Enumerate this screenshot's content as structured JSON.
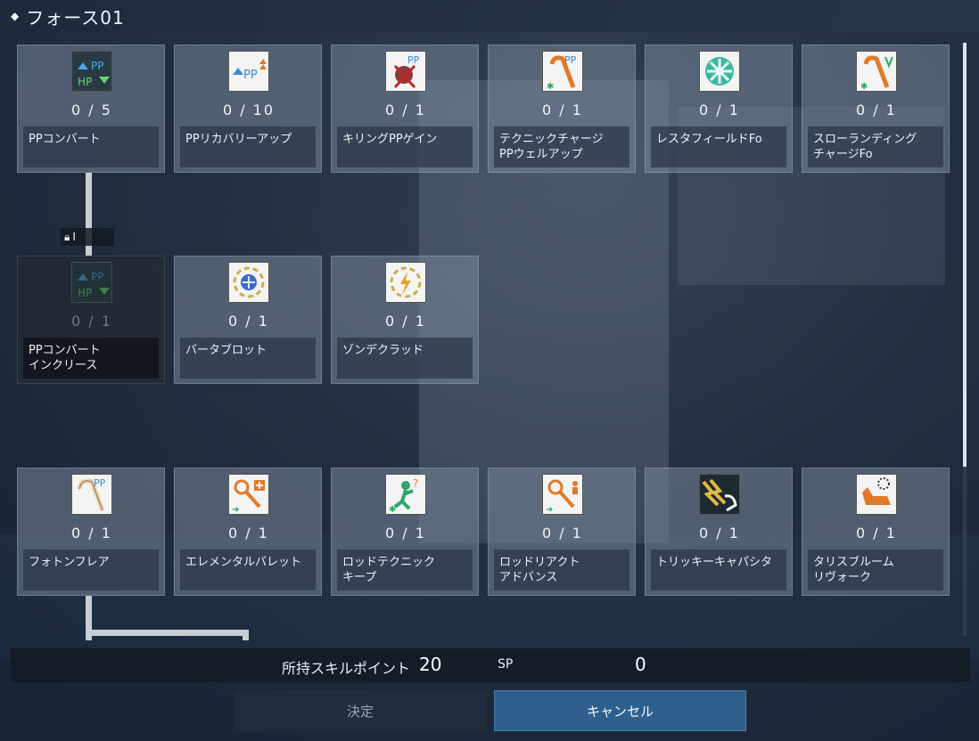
{
  "header": {
    "title": "フォース01"
  },
  "lock_badge": {
    "value": "I"
  },
  "rows": [
    [
      {
        "icon": "pp-convert-icon",
        "count": "0 / 5",
        "label": "PPコンバート",
        "locked": false
      },
      {
        "icon": "pp-recovery-up-icon",
        "count": "0 / 10",
        "label": "PPリカバリーアップ",
        "locked": false
      },
      {
        "icon": "killing-pp-gain-icon",
        "count": "0 / 1",
        "label": "キリングPPゲイン",
        "locked": false
      },
      {
        "icon": "technic-charge-pp-well-up-icon",
        "count": "0 / 1",
        "label": "テクニックチャージ\nPPウェルアップ",
        "locked": false
      },
      {
        "icon": "resta-field-fo-icon",
        "count": "0 / 1",
        "label": "レスタフィールドFo",
        "locked": false
      },
      {
        "icon": "slow-landing-charge-fo-icon",
        "count": "0 / 1",
        "label": "スローランディング\nチャージFo",
        "locked": false
      }
    ],
    [
      {
        "icon": "pp-convert-increase-icon",
        "count": "0 / 1",
        "label": "PPコンバート\nインクリース",
        "locked": true
      },
      {
        "icon": "barta-bullet-icon",
        "count": "0 / 1",
        "label": "バータブロット",
        "locked": false
      },
      {
        "icon": "zonde-clad-icon",
        "count": "0 / 1",
        "label": "ゾンデクラッド",
        "locked": false
      }
    ],
    [
      {
        "icon": "photon-flare-icon",
        "count": "0 / 1",
        "label": "フォトンフレア",
        "locked": false
      },
      {
        "icon": "elemental-bullet-icon",
        "count": "0 / 1",
        "label": "エレメンタルバレット",
        "locked": false
      },
      {
        "icon": "rod-technic-keep-icon",
        "count": "0 / 1",
        "label": "ロッドテクニック\nキープ",
        "locked": false
      },
      {
        "icon": "rod-react-advance-icon",
        "count": "0 / 1",
        "label": "ロッドリアクト\nアドバンス",
        "locked": false
      },
      {
        "icon": "tricky-capacitor-icon",
        "count": "0 / 1",
        "label": "トリッキーキャパシタ",
        "locked": false
      },
      {
        "icon": "talis-bloom-revoke-icon",
        "count": "0 / 1",
        "label": "タリスブルーム\nリヴォーク",
        "locked": false
      }
    ]
  ],
  "skill_points": {
    "label": "所持スキルポイント",
    "value": "20",
    "unit": "SP",
    "value2": "0"
  },
  "buttons": {
    "decide": "決定",
    "cancel": "キャンセル"
  },
  "colors": {
    "accent": "#2f5f8c",
    "card": "#7a8797",
    "connector": "#c9ced4"
  }
}
